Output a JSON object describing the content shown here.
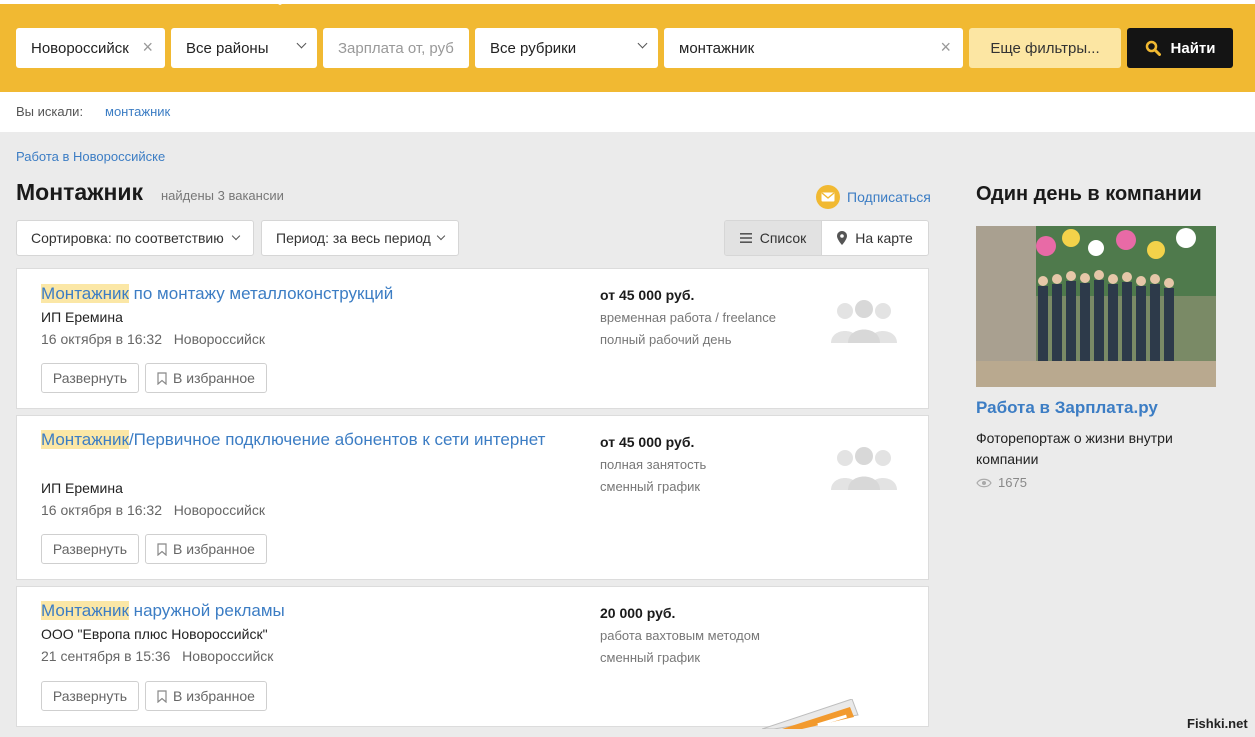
{
  "search": {
    "city": "Новороссийск",
    "district": "Все районы",
    "salary_placeholder": "Зарплата от, руб",
    "rubric": "Все рубрики",
    "query": "монтажник",
    "more_filters": "Еще фильтры...",
    "find_label": "Найти"
  },
  "searched": {
    "label": "Вы искали:",
    "term": "монтажник"
  },
  "breadcrumb": "Работа в Новороссийске",
  "page": {
    "title": "Монтажник",
    "found": "найдены 3 вакансии",
    "subscribe": "Подписаться"
  },
  "controls": {
    "sort": "Сортировка: по соответствию",
    "period": "Период: за весь период",
    "view_list": "Список",
    "view_map": "На карте"
  },
  "vacancies": [
    {
      "title_highlight": "Монтажник",
      "title_rest": " по монтажу металлоконструкций",
      "company": "ИП Еремина",
      "date": "16 октября в 16:32",
      "city": "Новороссийск",
      "salary": "от 45 000 руб.",
      "cond1": "временная работа / freelance",
      "cond2": "полный рабочий день",
      "expand": "Развернуть",
      "favorite": "В избранное"
    },
    {
      "title_highlight": "Монтажник",
      "title_rest": "/Первичное подключение абонентов к сети интернет",
      "company": "ИП Еремина",
      "date": "16 октября в 16:32",
      "city": "Новороссийск",
      "salary": "от 45 000 руб.",
      "cond1": "полная занятость",
      "cond2": "сменный график",
      "expand": "Развернуть",
      "favorite": "В избранное"
    },
    {
      "title_highlight": "Монтажник",
      "title_rest": " наружной рекламы",
      "company": "ООО \"Европа плюс Новороссийск\"",
      "date": "21 сентября в 15:36",
      "city": "Новороссийск",
      "salary": "20 000 руб.",
      "cond1": "работа вахтовым методом",
      "cond2": "сменный график",
      "expand": "Развернуть",
      "favorite": "В избранное"
    }
  ],
  "promo": {
    "heading": "Один день в компании",
    "link": "Работа в Зарплата.ру",
    "text": "Фоторепортаж о жизни внутри компании",
    "views": "1675"
  },
  "watermark": "Fishki.net",
  "colors": {
    "brand_yellow": "#f1b932",
    "link_blue": "#3c7dc4",
    "highlight": "#fbe7a6",
    "button_dark": "#141414"
  }
}
